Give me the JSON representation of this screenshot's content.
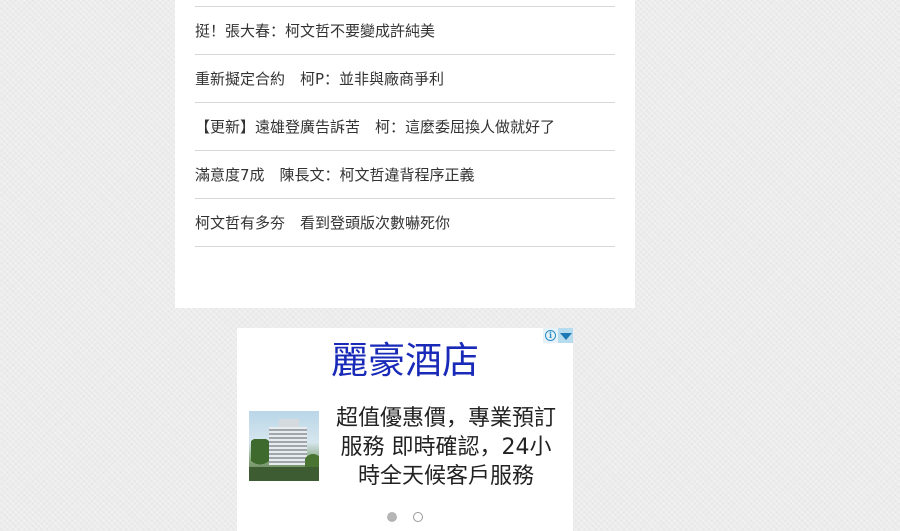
{
  "news": {
    "items": [
      {
        "title": "挺！張大春：柯文哲不要變成許純美"
      },
      {
        "title": "重新擬定合約　柯P：並非與廠商爭利"
      },
      {
        "title": "【更新】遠雄登廣告訴苦　柯：這麼委屈換人做就好了"
      },
      {
        "title": "滿意度7成　陳長文：柯文哲違背程序正義"
      },
      {
        "title": "柯文哲有多夯　看到登頭版次數嚇死你"
      }
    ]
  },
  "ad": {
    "title": "麗豪酒店",
    "description": "超值優惠價，專業預訂服務 即時確認，24小時全天候客戶服務",
    "info_glyph": "i",
    "image_icon": "hotel-building-photo",
    "slides": [
      {
        "state": "active"
      },
      {
        "state": "inactive"
      }
    ],
    "colors": {
      "title": "#1a2ab8",
      "adchoices": "#2a8ec7"
    }
  }
}
